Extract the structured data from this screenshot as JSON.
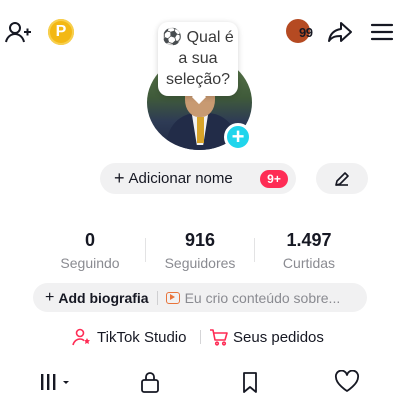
{
  "topbar": {
    "coin_letter": "P",
    "notifications_count": "99",
    "icons": [
      "add-friend-icon",
      "coin-icon",
      "share-icon",
      "menu-icon"
    ]
  },
  "prompt_bubble": {
    "text": "⚽ Qual é a sua seleção?"
  },
  "profile": {
    "name_button": "Adicionar nome",
    "name_badge": "9+"
  },
  "stats": [
    {
      "value": "0",
      "label": "Seguindo"
    },
    {
      "value": "916",
      "label": "Seguidores"
    },
    {
      "value": "1.497",
      "label": "Curtidas"
    }
  ],
  "bio": {
    "add_label": "Add biografia",
    "suggestion": "Eu crio conteúdo sobre..."
  },
  "links": {
    "studio": "TikTok Studio",
    "orders": "Seus pedidos"
  },
  "colors": {
    "accent_red": "#fe2c55",
    "avatar_plus": "#20d5ec",
    "coin": "#f3b814"
  }
}
